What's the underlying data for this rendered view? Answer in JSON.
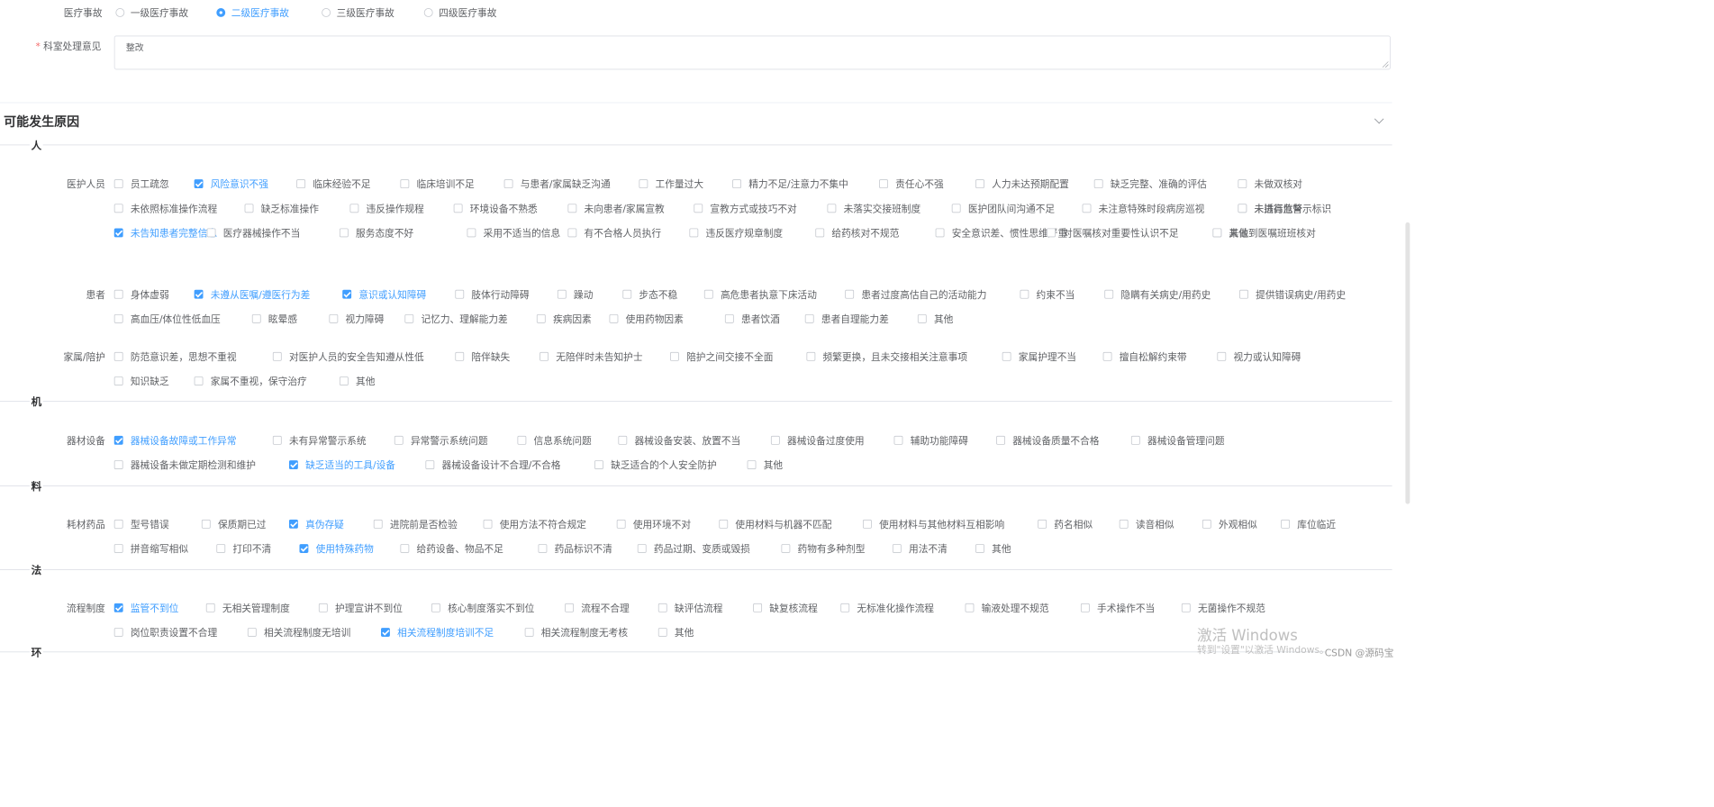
{
  "accident": {
    "label": "医疗事故",
    "options": [
      "一级医疗事故",
      "二级医疗事故",
      "三级医疗事故",
      "四级医疗事故"
    ],
    "selected": "二级医疗事故"
  },
  "dept_opinion": {
    "label": "科室处理意见",
    "value": "整改"
  },
  "causes": {
    "title": "可能发生原因",
    "sections": [
      {
        "name": "人",
        "groups": [
          {
            "label": "医护人员",
            "items": [
              {
                "t": "员工疏忽",
                "c": false
              },
              {
                "t": "风险意识不强",
                "c": true
              },
              {
                "t": "临床经验不足",
                "c": false
              },
              {
                "t": "临床培训不足",
                "c": false
              },
              {
                "t": "与患者/家属缺乏沟通",
                "c": false
              },
              {
                "t": "工作量过大",
                "c": false
              },
              {
                "t": "精力不足/注意力不集中",
                "c": false
              },
              {
                "t": "责任心不强",
                "c": false
              },
              {
                "t": "人力未达预期配置",
                "c": false
              },
              {
                "t": "缺乏完整、准确的评估",
                "c": false
              },
              {
                "t": "未做双核对",
                "c": false
              },
              {
                "t": "未依照标准操作流程",
                "c": false
              },
              {
                "t": "缺乏标准操作",
                "c": false
              },
              {
                "t": "违反操作规程",
                "c": false
              },
              {
                "t": "环境设备不熟悉",
                "c": false
              },
              {
                "t": "未向患者/家属宣教",
                "c": false
              },
              {
                "t": "宣教方式或技巧不对",
                "c": false
              },
              {
                "t": "未落实交接班制度",
                "c": false
              },
              {
                "t": "医护团队间沟通不足",
                "c": false
              },
              {
                "t": "未注意特殊时段病房巡视",
                "c": false
              },
              {
                "t": "未插高危警示标识",
                "c": false
              },
              {
                "t": "未进行监督",
                "c": false
              },
              {
                "t": "未告知患者完整信息",
                "c": true
              },
              {
                "t": "医疗器械操作不当",
                "c": false
              },
              {
                "t": "服务态度不好",
                "c": false
              },
              {
                "t": "采用不适当的信息",
                "c": false
              },
              {
                "t": "有不合格人员执行",
                "c": false
              },
              {
                "t": "违反医疗规章制度",
                "c": false
              },
              {
                "t": "给药核对不规范",
                "c": false
              },
              {
                "t": "安全意识差、惯性思维严重",
                "c": false
              },
              {
                "t": "对医嘱核对重要性认识不足",
                "c": false
              },
              {
                "t": "未做到医嘱班班核对",
                "c": false
              },
              {
                "t": "其他",
                "c": false
              }
            ]
          },
          {
            "label": "患者",
            "items": [
              {
                "t": "身体虚弱",
                "c": false
              },
              {
                "t": "未遵从医嘱/遵医行为差",
                "c": true
              },
              {
                "t": "意识或认知障碍",
                "c": true
              },
              {
                "t": "肢体行动障碍",
                "c": false
              },
              {
                "t": "躁动",
                "c": false
              },
              {
                "t": "步态不稳",
                "c": false
              },
              {
                "t": "高危患者执意下床活动",
                "c": false
              },
              {
                "t": "患者过度高估自己的活动能力",
                "c": false
              },
              {
                "t": "约束不当",
                "c": false
              },
              {
                "t": "隐瞒有关病史/用药史",
                "c": false
              },
              {
                "t": "提供错误病史/用药史",
                "c": false
              },
              {
                "t": "高血压/体位性低血压",
                "c": false
              },
              {
                "t": "眩晕感",
                "c": false
              },
              {
                "t": "视力障碍",
                "c": false
              },
              {
                "t": "记忆力、理解能力差",
                "c": false
              },
              {
                "t": "疾病因素",
                "c": false
              },
              {
                "t": "使用药物因素",
                "c": false
              },
              {
                "t": "患者饮酒",
                "c": false
              },
              {
                "t": "患者自理能力差",
                "c": false
              },
              {
                "t": "其他",
                "c": false
              }
            ]
          },
          {
            "label": "家属/陪护",
            "items": [
              {
                "t": "防范意识差，思想不重视",
                "c": false
              },
              {
                "t": "对医护人员的安全告知遵从性低",
                "c": false
              },
              {
                "t": "陪伴缺失",
                "c": false
              },
              {
                "t": "无陪伴时未告知护士",
                "c": false
              },
              {
                "t": "陪护之间交接不全面",
                "c": false
              },
              {
                "t": "频繁更换，且未交接相关注意事项",
                "c": false
              },
              {
                "t": "家属护理不当",
                "c": false
              },
              {
                "t": "擅自松解约束带",
                "c": false
              },
              {
                "t": "视力或认知障碍",
                "c": false
              },
              {
                "t": "知识缺乏",
                "c": false
              },
              {
                "t": "家属不重视，保守治疗",
                "c": false
              },
              {
                "t": "其他",
                "c": false
              }
            ]
          }
        ]
      },
      {
        "name": "机",
        "groups": [
          {
            "label": "器材设备",
            "items": [
              {
                "t": "器械设备故障或工作异常",
                "c": true
              },
              {
                "t": "未有异常警示系统",
                "c": false
              },
              {
                "t": "异常警示系统问题",
                "c": false
              },
              {
                "t": "信息系统问题",
                "c": false
              },
              {
                "t": "器械设备安装、放置不当",
                "c": false
              },
              {
                "t": "器械设备过度使用",
                "c": false
              },
              {
                "t": "辅助功能障碍",
                "c": false
              },
              {
                "t": "器械设备质量不合格",
                "c": false
              },
              {
                "t": "器械设备管理问题",
                "c": false
              },
              {
                "t": "器械设备未做定期检测和维护",
                "c": false
              },
              {
                "t": "缺乏适当的工具/设备",
                "c": true
              },
              {
                "t": "器械设备设计不合理/不合格",
                "c": false
              },
              {
                "t": "缺乏适合的个人安全防护",
                "c": false
              },
              {
                "t": "其他",
                "c": false
              }
            ]
          }
        ]
      },
      {
        "name": "料",
        "groups": [
          {
            "label": "耗材药品",
            "items": [
              {
                "t": "型号错误",
                "c": false
              },
              {
                "t": "保质期已过",
                "c": false
              },
              {
                "t": "真伪存疑",
                "c": true
              },
              {
                "t": "进院前是否检验",
                "c": false
              },
              {
                "t": "使用方法不符合规定",
                "c": false
              },
              {
                "t": "使用环境不对",
                "c": false
              },
              {
                "t": "使用材料与机器不匹配",
                "c": false
              },
              {
                "t": "使用材料与其他材料互相影响",
                "c": false
              },
              {
                "t": "药名相似",
                "c": false
              },
              {
                "t": "读音相似",
                "c": false
              },
              {
                "t": "外观相似",
                "c": false
              },
              {
                "t": "库位临近",
                "c": false
              },
              {
                "t": "拼音缩写相似",
                "c": false
              },
              {
                "t": "打印不清",
                "c": false
              },
              {
                "t": "使用特殊药物",
                "c": true
              },
              {
                "t": "给药设备、物品不足",
                "c": false
              },
              {
                "t": "药品标识不清",
                "c": false
              },
              {
                "t": "药品过期、变质或毁损",
                "c": false
              },
              {
                "t": "药物有多种剂型",
                "c": false
              },
              {
                "t": "用法不清",
                "c": false
              },
              {
                "t": "其他",
                "c": false
              }
            ]
          }
        ]
      },
      {
        "name": "法",
        "groups": [
          {
            "label": "流程制度",
            "items": [
              {
                "t": "监管不到位",
                "c": true
              },
              {
                "t": "无相关管理制度",
                "c": false
              },
              {
                "t": "护理宣讲不到位",
                "c": false
              },
              {
                "t": "核心制度落实不到位",
                "c": false
              },
              {
                "t": "流程不合理",
                "c": false
              },
              {
                "t": "缺评估流程",
                "c": false
              },
              {
                "t": "缺复核流程",
                "c": false
              },
              {
                "t": "无标准化操作流程",
                "c": false
              },
              {
                "t": "输液处理不规范",
                "c": false
              },
              {
                "t": "手术操作不当",
                "c": false
              },
              {
                "t": "无菌操作不规范",
                "c": false
              },
              {
                "t": "岗位职责设置不合理",
                "c": false
              },
              {
                "t": "相关流程制度无培训",
                "c": false
              },
              {
                "t": "相关流程制度培训不足",
                "c": true
              },
              {
                "t": "相关流程制度无考核",
                "c": false
              },
              {
                "t": "其他",
                "c": false
              }
            ]
          }
        ]
      },
      {
        "name": "环",
        "groups": []
      }
    ]
  },
  "watermark": {
    "line1": "激活 Windows",
    "line2": "转到\"设置\"以激活 Windows。"
  },
  "credit": "CSDN @源码宝",
  "colors": {
    "accent": "#409eff",
    "required": "#f56c6c",
    "text": "#606266"
  },
  "icons": {
    "collapse": "chevron-down-icon"
  }
}
